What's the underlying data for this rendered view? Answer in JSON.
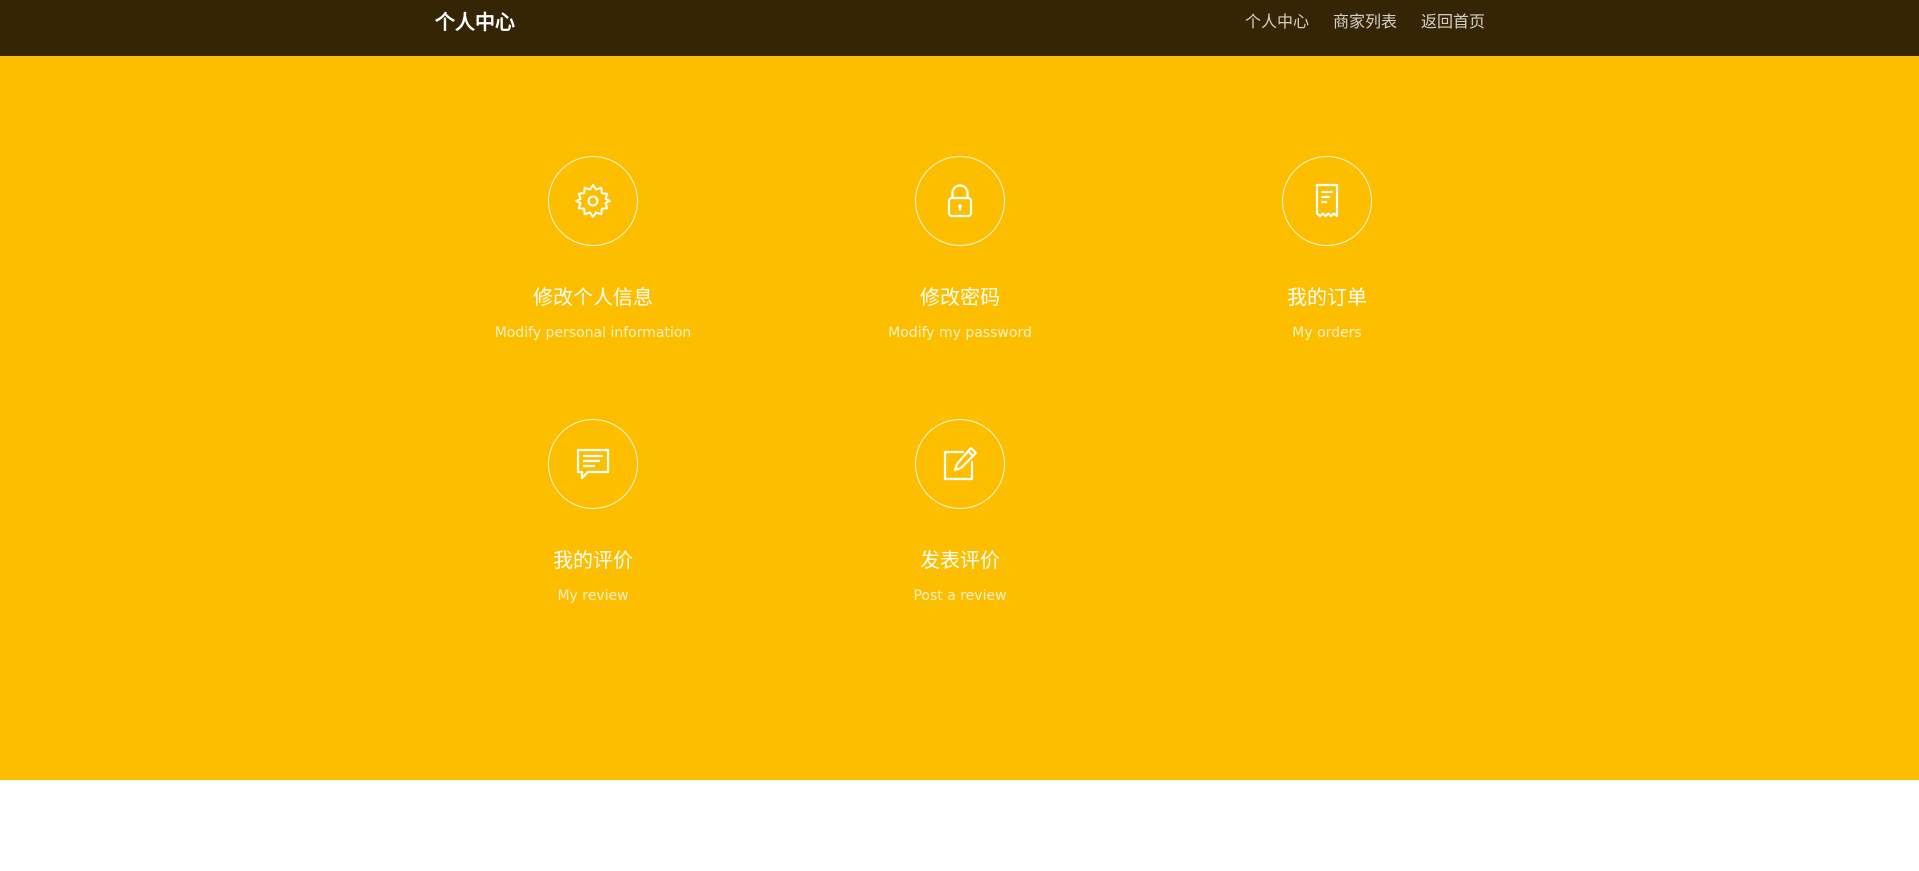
{
  "navbar": {
    "brand": "个人中心",
    "links": [
      "个人中心",
      "商家列表",
      "返回首页"
    ]
  },
  "colors": {
    "navbar_bg": "#352505",
    "hero_bg": "#fdbe00",
    "text": "#ffffff"
  },
  "cards": [
    {
      "title": "修改个人信息",
      "subtitle": "Modify personal information",
      "icon": "gear-icon"
    },
    {
      "title": "修改密码",
      "subtitle": "Modify my password",
      "icon": "lock-icon"
    },
    {
      "title": "我的订单",
      "subtitle": "My orders",
      "icon": "receipt-icon"
    },
    {
      "title": "我的评价",
      "subtitle": "My review",
      "icon": "comment-icon"
    },
    {
      "title": "发表评价",
      "subtitle": "Post a review",
      "icon": "edit-icon"
    }
  ]
}
